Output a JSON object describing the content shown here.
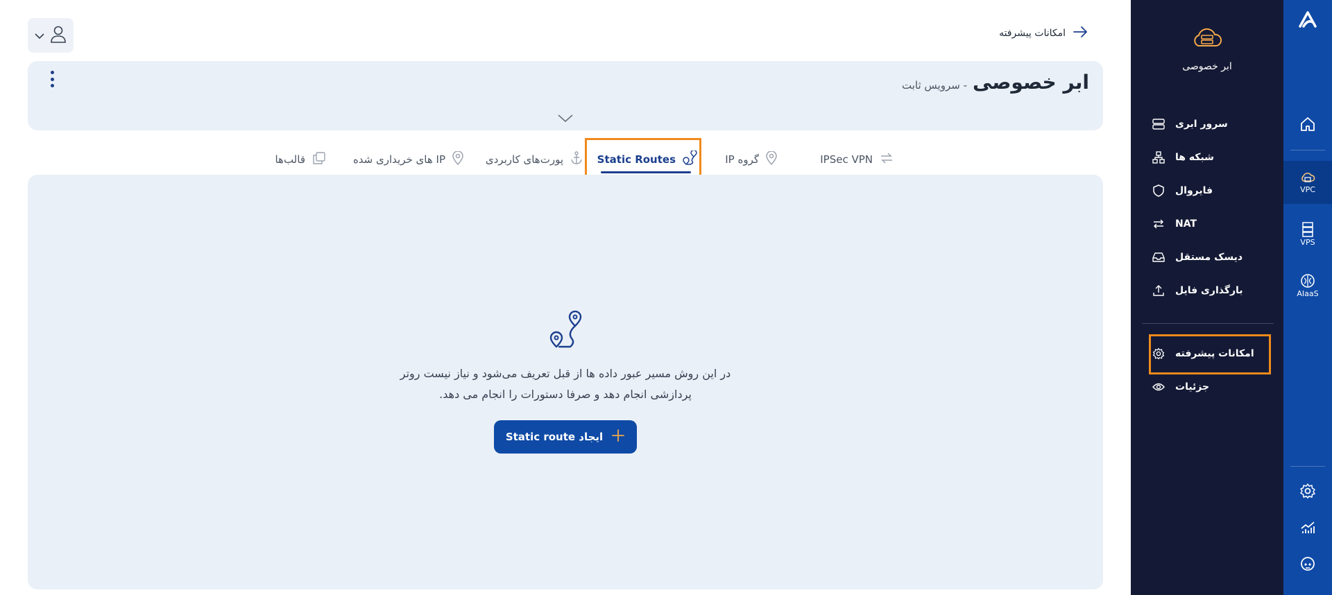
{
  "rail": {
    "items": [
      {
        "label": "",
        "icon": "home-icon"
      },
      {
        "label": "VPC",
        "icon": "cloud-server-icon"
      },
      {
        "label": "VPS",
        "icon": "server-rack-icon"
      },
      {
        "label": "AIaaS",
        "icon": "ai-brain-icon"
      }
    ],
    "bottom_icons": [
      "settings-icon",
      "chart-icon",
      "support-headset-icon"
    ]
  },
  "sidebar": {
    "title": "ابر خصوصی",
    "items": [
      {
        "label": "سرور ابری",
        "icon": "server-icon"
      },
      {
        "label": "شبکه ها",
        "icon": "network-icon"
      },
      {
        "label": "فایروال",
        "icon": "shield-icon"
      },
      {
        "label": "NAT",
        "icon": "nat-arrows-icon"
      },
      {
        "label": "دیسک مستقل",
        "icon": "disk-icon"
      },
      {
        "label": "بارگذاری فایل",
        "icon": "upload-icon"
      },
      {
        "label": "امکانات پیشرفته",
        "icon": "gear-icon"
      },
      {
        "label": "جزئیات",
        "icon": "eye-icon"
      }
    ]
  },
  "topbar": {
    "back_label": "امکانات پیشرفته"
  },
  "header": {
    "title": "ابر خصوصی",
    "subtitle": "- سرویس ثابت"
  },
  "tabs": [
    {
      "label": "IPSec VPN",
      "icon": "swap-arrows-icon"
    },
    {
      "label": "گروه IP",
      "icon": "location-pin-icon"
    },
    {
      "label": "Static Routes",
      "icon": "route-icon",
      "active": true
    },
    {
      "label": "پورت‌های کاربردی",
      "icon": "anchor-icon"
    },
    {
      "label": "IP های خریداری شده",
      "icon": "location-pin-icon"
    },
    {
      "label": "قالب‌ها",
      "icon": "templates-icon"
    }
  ],
  "empty_state": {
    "line1": "در این روش مسیر عبور داده ها از قبل تعریف می‌شود و نیاز نیست روتر",
    "line2": "پردازشی انجام دهد و صرفا دستورات را انجام می دهد.",
    "button_label": "ایجاد Static route"
  },
  "colors": {
    "rail": "#0f4aa6",
    "sidebar": "#141a35",
    "card": "#eaf0f7",
    "accent": "#1b3f8e",
    "highlight": "#f08a1c"
  }
}
